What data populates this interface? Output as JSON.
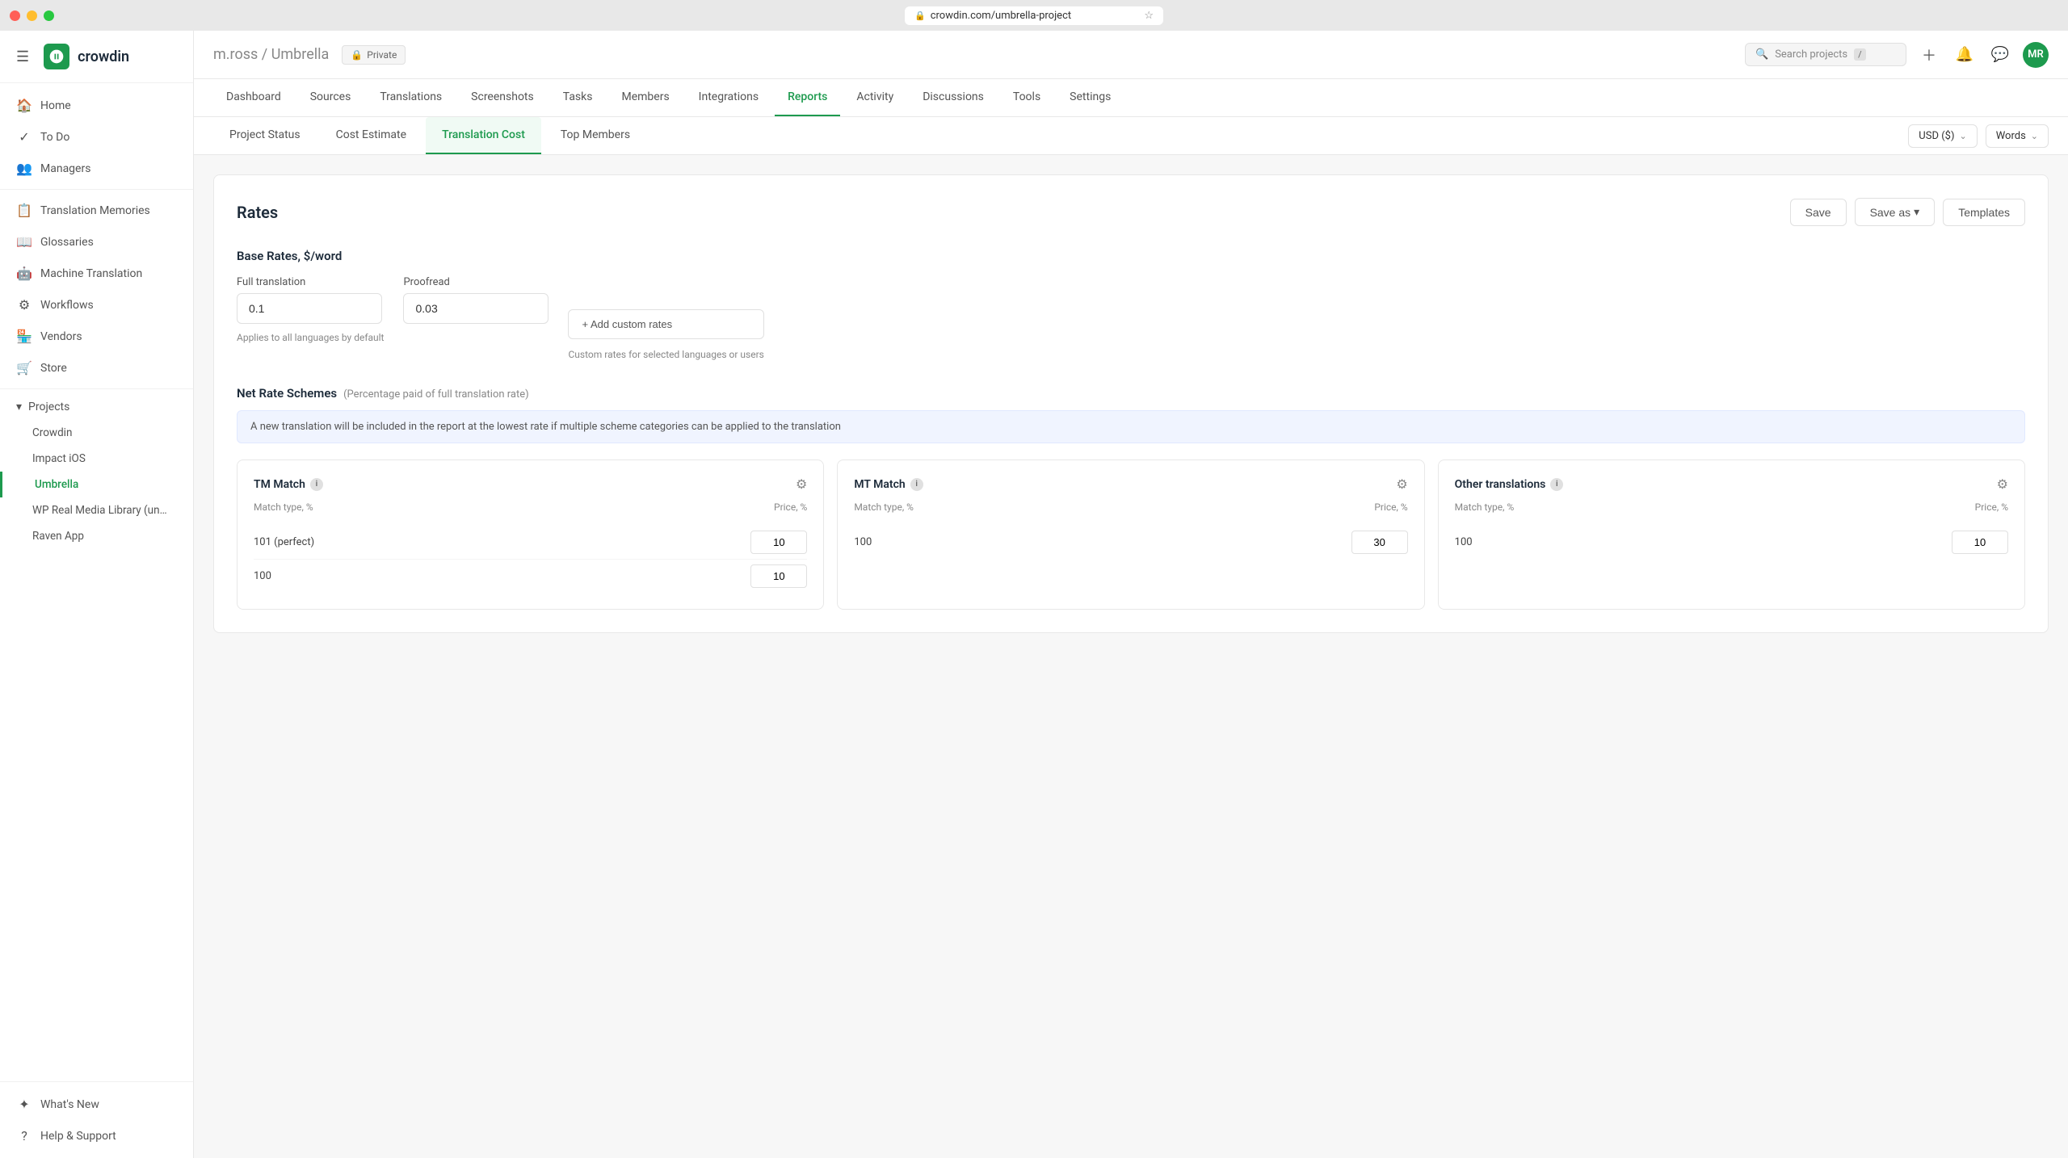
{
  "titlebar": {
    "url": "crowdin.com/umbrella-project",
    "close_label": "",
    "minimize_label": "",
    "maximize_label": ""
  },
  "sidebar": {
    "brand": "crowdin",
    "hamburger_label": "☰",
    "nav_items": [
      {
        "id": "home",
        "label": "Home",
        "icon": "🏠"
      },
      {
        "id": "todo",
        "label": "To Do",
        "icon": "✓"
      },
      {
        "id": "managers",
        "label": "Managers",
        "icon": "👥"
      },
      {
        "id": "translation-memories",
        "label": "Translation Memories",
        "icon": "📋"
      },
      {
        "id": "glossaries",
        "label": "Glossaries",
        "icon": "📖"
      },
      {
        "id": "machine-translation",
        "label": "Machine Translation",
        "icon": "🤖"
      },
      {
        "id": "workflows",
        "label": "Workflows",
        "icon": "⚙"
      },
      {
        "id": "vendors",
        "label": "Vendors",
        "icon": "🏪"
      },
      {
        "id": "store",
        "label": "Store",
        "icon": "🛒"
      }
    ],
    "projects_label": "Projects",
    "projects": [
      {
        "id": "crowdin",
        "label": "Crowdin"
      },
      {
        "id": "impact-ios",
        "label": "Impact iOS"
      },
      {
        "id": "umbrella",
        "label": "Umbrella",
        "active": true
      },
      {
        "id": "wp-real",
        "label": "WP Real Media Library (un…"
      },
      {
        "id": "raven-app",
        "label": "Raven App"
      }
    ],
    "bottom_items": [
      {
        "id": "whats-new",
        "label": "What's New",
        "icon": "✦"
      },
      {
        "id": "help",
        "label": "Help & Support",
        "icon": "?"
      }
    ]
  },
  "topbar": {
    "breadcrumb_user": "m.ross",
    "breadcrumb_project": "Umbrella",
    "private_label": "Private",
    "search_placeholder": "Search projects",
    "search_kbd": "/",
    "avatar_initials": "MR"
  },
  "subnav": {
    "items": [
      {
        "id": "dashboard",
        "label": "Dashboard"
      },
      {
        "id": "sources",
        "label": "Sources"
      },
      {
        "id": "translations",
        "label": "Translations"
      },
      {
        "id": "screenshots",
        "label": "Screenshots"
      },
      {
        "id": "tasks",
        "label": "Tasks"
      },
      {
        "id": "members",
        "label": "Members"
      },
      {
        "id": "integrations",
        "label": "Integrations"
      },
      {
        "id": "reports",
        "label": "Reports",
        "active": true
      },
      {
        "id": "activity",
        "label": "Activity"
      },
      {
        "id": "discussions",
        "label": "Discussions"
      },
      {
        "id": "tools",
        "label": "Tools"
      },
      {
        "id": "settings",
        "label": "Settings"
      }
    ]
  },
  "content_tabs": {
    "tabs": [
      {
        "id": "project-status",
        "label": "Project Status"
      },
      {
        "id": "cost-estimate",
        "label": "Cost Estimate"
      },
      {
        "id": "translation-cost",
        "label": "Translation Cost",
        "active": true
      },
      {
        "id": "top-members",
        "label": "Top Members"
      }
    ],
    "currency_label": "USD ($)",
    "currency_caret": "⌄",
    "words_label": "Words",
    "words_caret": "⌄"
  },
  "rates": {
    "title": "Rates",
    "save_label": "Save",
    "save_as_label": "Save as",
    "save_as_caret": "▾",
    "templates_label": "Templates",
    "base_rates_title": "Base Rates, $/word",
    "full_translation_label": "Full translation",
    "full_translation_value": "0.1",
    "proofread_label": "Proofread",
    "proofread_value": "0.03",
    "add_custom_label": "+ Add custom rates",
    "applies_hint": "Applies to all languages by default",
    "custom_hint": "Custom rates for selected languages or users",
    "net_rate_title": "Net Rate Schemes",
    "net_rate_subtitle": "(Percentage paid of full translation rate)",
    "info_message": "A new translation will be included in the report at the lowest rate if multiple scheme categories can be applied to the translation",
    "tm_match": {
      "title": "TM Match",
      "col_match": "Match type, %",
      "col_price": "Price, %",
      "rows": [
        {
          "match": "101 (perfect)",
          "price": "10"
        },
        {
          "match": "100",
          "price": "10"
        }
      ]
    },
    "mt_match": {
      "title": "MT Match",
      "col_match": "Match type, %",
      "col_price": "Price, %",
      "rows": [
        {
          "match": "100",
          "price": "30"
        }
      ]
    },
    "other_translations": {
      "title": "Other translations",
      "col_match": "Match type, %",
      "col_price": "Price, %",
      "rows": [
        {
          "match": "100",
          "price": "10"
        }
      ]
    }
  }
}
